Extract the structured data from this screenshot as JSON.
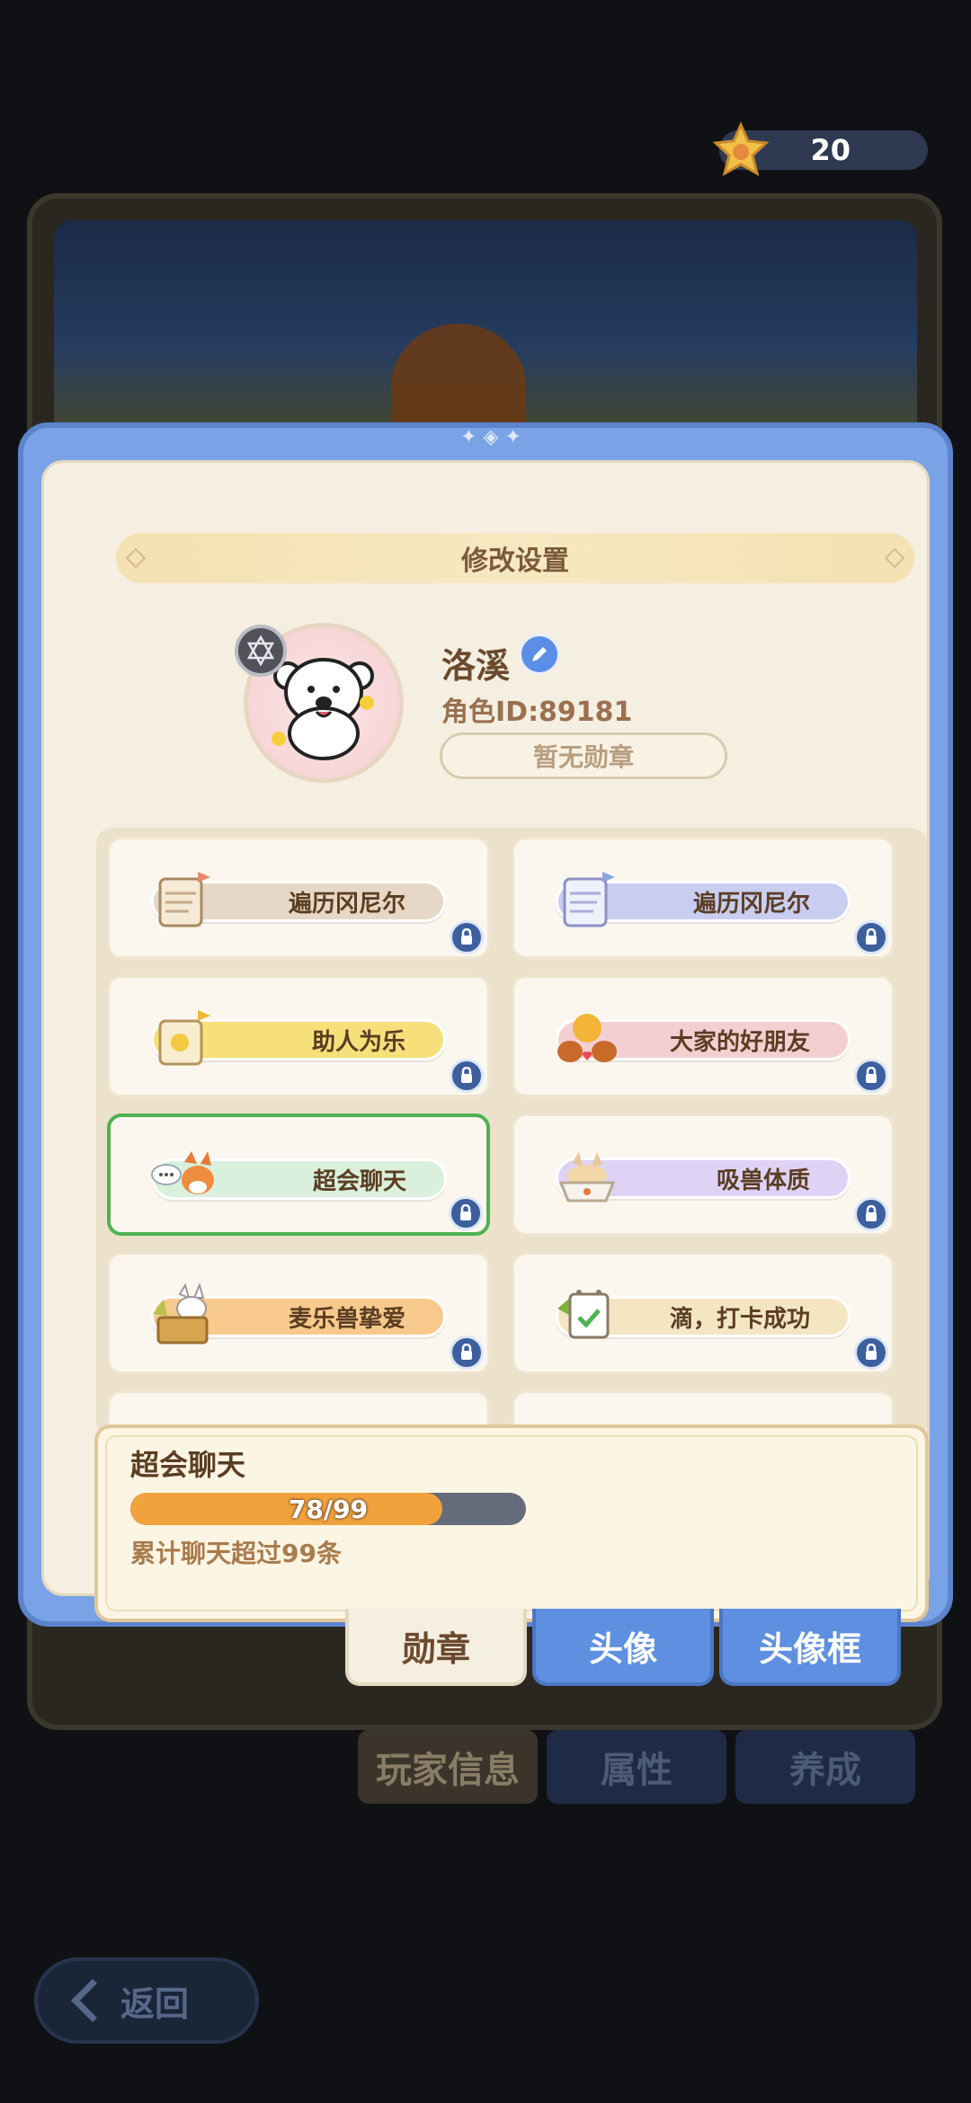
{
  "currency": {
    "amount": "20"
  },
  "modal": {
    "title": "修改设置"
  },
  "profile": {
    "name": "洛溪",
    "id_label": "角色ID:89181",
    "badge_status": "暂无勋章"
  },
  "medals": [
    {
      "label": "遍历冈尼尔",
      "color": "#e6d7c6",
      "locked": true,
      "selected": false
    },
    {
      "label": "遍历冈尼尔",
      "color": "#c9cdf0",
      "locked": true,
      "selected": false
    },
    {
      "label": "助人为乐",
      "color": "#f7e07a",
      "locked": true,
      "selected": false
    },
    {
      "label": "大家的好朋友",
      "color": "#f4cfd2",
      "locked": true,
      "selected": false
    },
    {
      "label": "超会聊天",
      "color": "#d9f0dd",
      "locked": true,
      "selected": true
    },
    {
      "label": "吸兽体质",
      "color": "#ded3f5",
      "locked": true,
      "selected": false
    },
    {
      "label": "麦乐兽挚爱",
      "color": "#f8c98c",
      "locked": true,
      "selected": false
    },
    {
      "label": "滴，打卡成功",
      "color": "#f4e6c3",
      "locked": true,
      "selected": false
    }
  ],
  "detail": {
    "title": "超会聊天",
    "progress_text": "78/99",
    "progress_value": 78,
    "progress_max": 99,
    "description": "累计聊天超过99条"
  },
  "tabs": {
    "medal": "勋章",
    "avatar": "头像",
    "avatar_frame": "头像框"
  },
  "background": {
    "tabs": [
      "玩家信息",
      "属性",
      "养成"
    ],
    "back_label": "返回"
  },
  "colors": {
    "modal_blue": "#7aa2e6",
    "panel_cream": "#f5efe1",
    "selected_green": "#4fb252",
    "progress_orange": "#f2a23d"
  }
}
